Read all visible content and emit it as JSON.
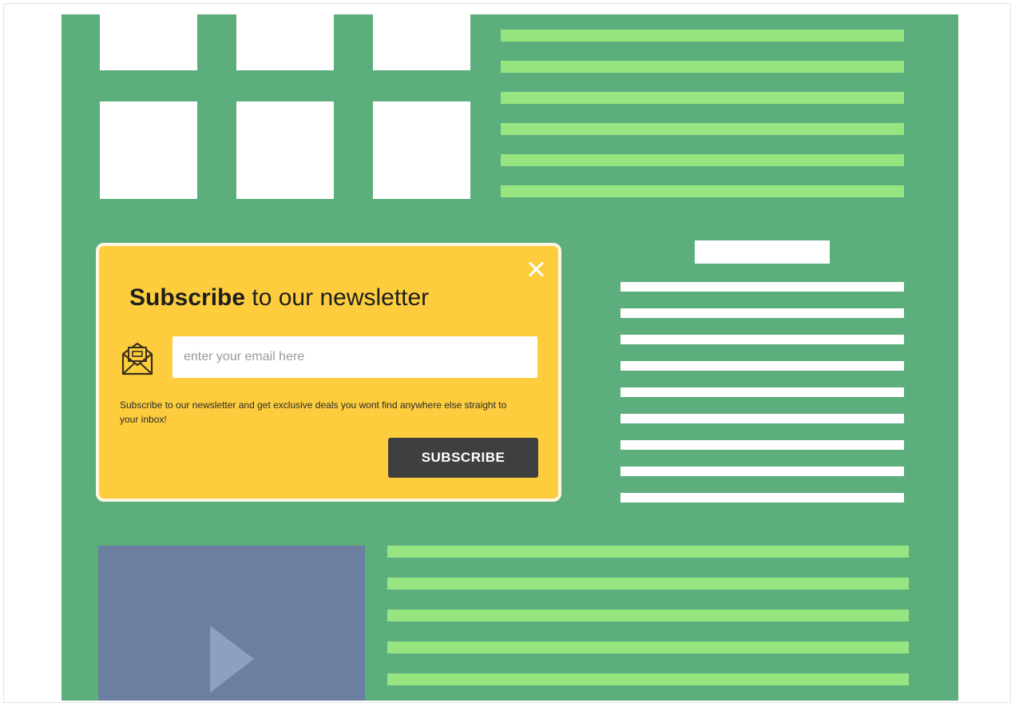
{
  "popup": {
    "close_icon": "close-icon",
    "title_bold": "Subscribe",
    "title_rest": " to our newsletter",
    "mail_icon": "envelope-icon",
    "email_placeholder": "enter your email here",
    "description": "Subscribe to our newsletter and get exclusive deals you wont find anywhere else straight to your inbox!",
    "button_label": "SUBSCRIBE"
  },
  "video": {
    "icon": "play-icon"
  },
  "colors": {
    "page_background": "#5caf7c",
    "placeholder_line": "#96e581",
    "popup_background": "#fdcd3e",
    "button_background": "#3f3f3f",
    "video_background": "#6c7fa0"
  }
}
